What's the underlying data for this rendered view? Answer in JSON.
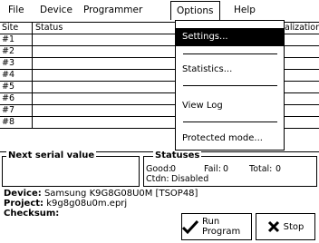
{
  "menu": [
    {
      "label": "File"
    },
    {
      "label": "Device"
    },
    {
      "label": "Programmer"
    },
    {
      "label": "Options"
    },
    {
      "label": "Help"
    }
  ],
  "table": {
    "headers": {
      "site": "Site",
      "status": "Status",
      "third": "alization"
    },
    "rows": [
      {
        "site": "#1"
      },
      {
        "site": "#2"
      },
      {
        "site": "#3"
      },
      {
        "site": "#4"
      },
      {
        "site": "#5"
      },
      {
        "site": "#6"
      },
      {
        "site": "#7"
      },
      {
        "site": "#8"
      }
    ]
  },
  "options_menu": [
    {
      "label": "Settings..."
    },
    {
      "label": "Statistics..."
    },
    {
      "label": "View Log"
    },
    {
      "label": "Protected mode..."
    }
  ],
  "next_serial": {
    "title": "Next serial value"
  },
  "statuses": {
    "title": "Statuses",
    "good_label": "Good:",
    "good_value": "0",
    "fail_label": "Fail:",
    "fail_value": "0",
    "total_label": "Total:",
    "total_value": "0",
    "ctdn_label": "Ctdn:",
    "ctdn_value": "Disabled"
  },
  "info": {
    "device_label": "Device:",
    "device_value": "Samsung  K9G8G08U0M [TSOP48]",
    "project_label": "Project:",
    "project_value": "k9g8g08u0m.eprj",
    "checksum_label": "Checksum:"
  },
  "buttons": {
    "run": "Run Program",
    "stop": "Stop"
  },
  "icons": {
    "run": "checkmark-icon",
    "stop": "cross-icon"
  }
}
